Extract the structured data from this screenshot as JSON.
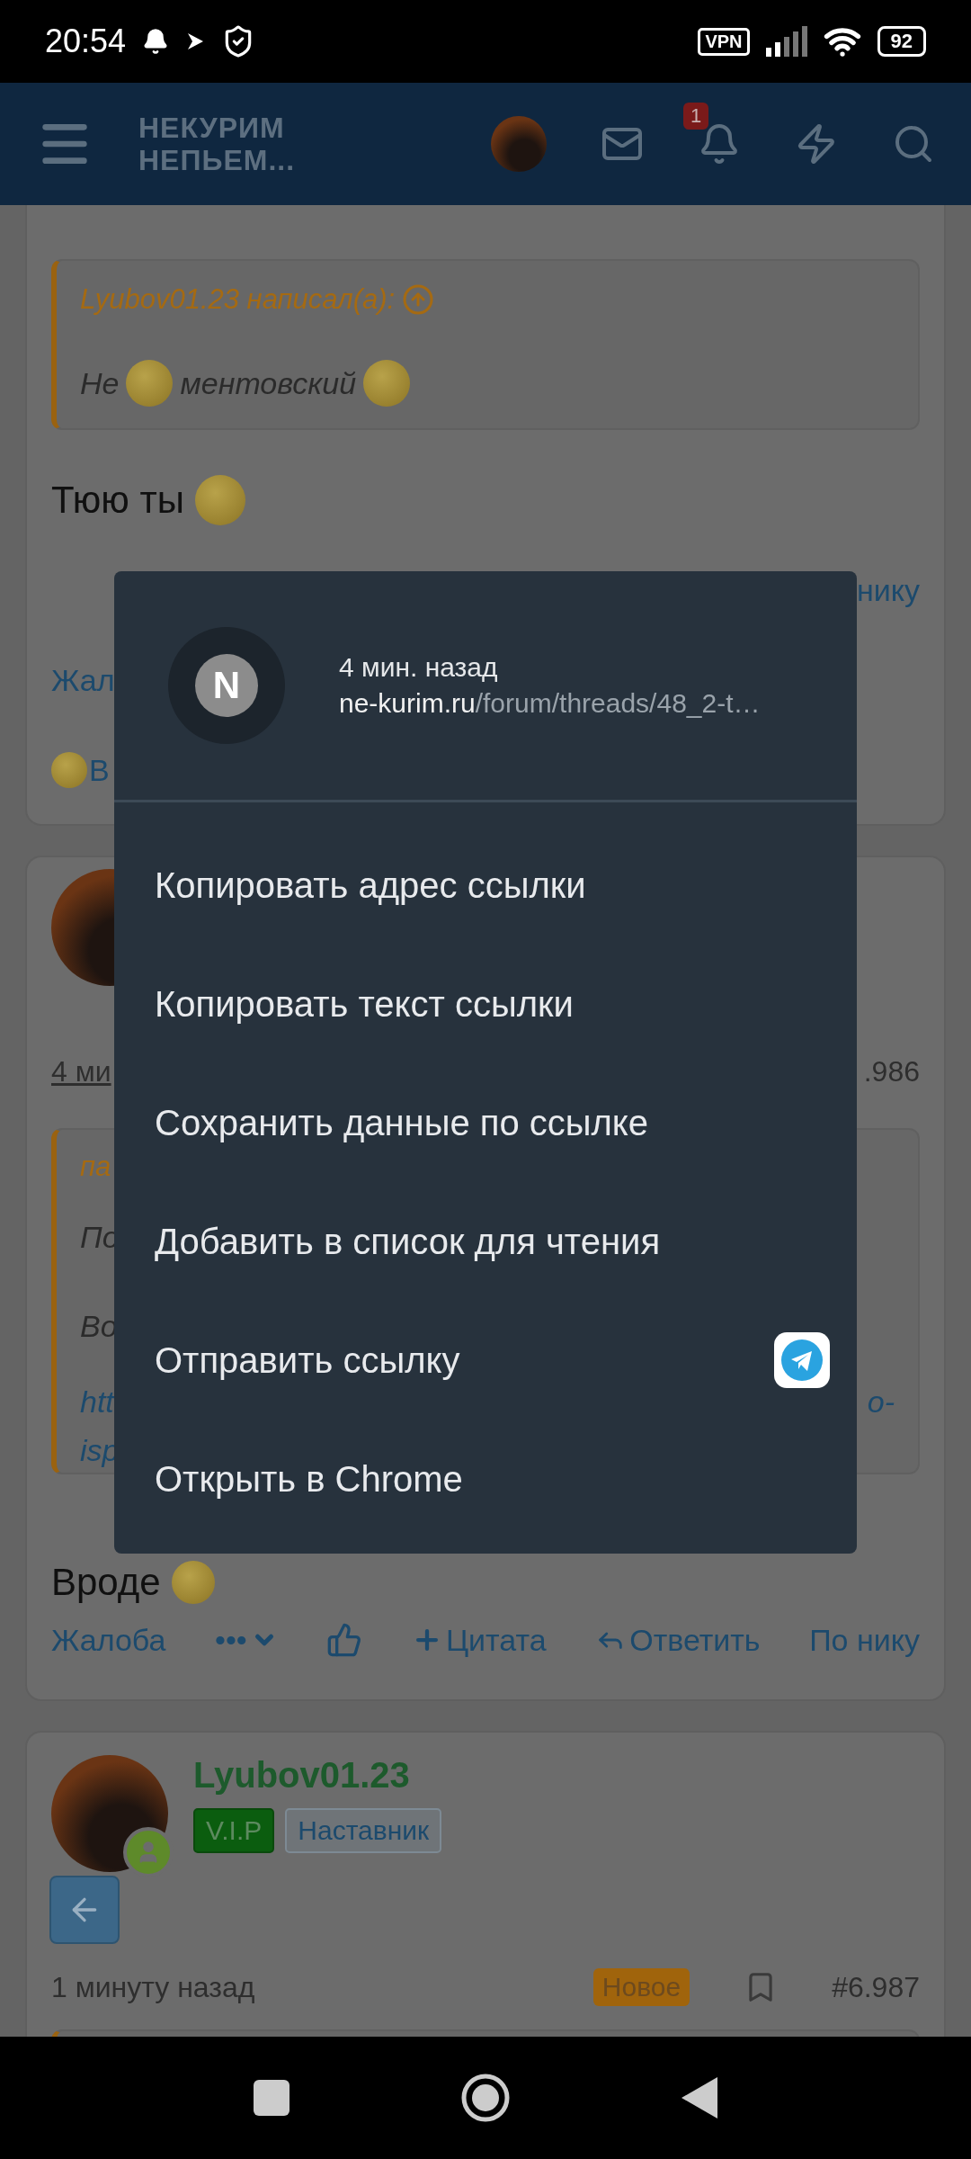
{
  "status_bar": {
    "time": "20:54",
    "vpn": "VPN",
    "battery": "92"
  },
  "header": {
    "logo_lines": [
      "НЕКУРИМ",
      "НЕПЬЕМ..."
    ],
    "notification_count": "1"
  },
  "post_1": {
    "quote_author": "Lyubov01.23 написал(а):",
    "quote_parts": [
      "Не",
      "ментовский"
    ],
    "message": "Тюю ты",
    "fragment_right": "нику",
    "fragment_left": "Жал",
    "reaction_fragment": "В"
  },
  "post_2": {
    "time_fragment": "4 ми",
    "number_fragment": ".986",
    "quote_lines": [
      {
        "kind": "author",
        "left": "па"
      },
      {
        "kind": "text",
        "left": "По"
      },
      {
        "kind": "text",
        "left": "Во"
      },
      {
        "kind": "link",
        "left": "htt",
        "right": "o-"
      },
      {
        "kind": "link",
        "left": "isp"
      }
    ],
    "message": "Вроде",
    "actions": [
      {
        "kind": "report",
        "label": "Жалоба"
      },
      {
        "kind": "more",
        "label": "•••"
      },
      {
        "kind": "like"
      },
      {
        "kind": "quote",
        "label": "Цитата"
      },
      {
        "kind": "reply",
        "label": "Ответить"
      },
      {
        "kind": "nick",
        "label": "По нику"
      }
    ]
  },
  "post_3": {
    "author": "Lyubov01.23",
    "online": true,
    "badges": [
      {
        "kind": "vip",
        "label": "V.I.P"
      },
      {
        "kind": "role",
        "label": "Наставник"
      }
    ],
    "time": "1 минуту назад",
    "new_label": "Новое",
    "number": "#6.987"
  },
  "context_menu": {
    "favicon_letter": "N",
    "time": "4 мин. назад",
    "url_host": "ne-kurim.ru",
    "url_path": "/forum/threads/48_2-t…",
    "items": [
      {
        "kind": "plain",
        "label": "Копировать адрес ссылки"
      },
      {
        "kind": "plain",
        "label": "Копировать текст ссылки"
      },
      {
        "kind": "plain",
        "label": "Сохранить данные по ссылке"
      },
      {
        "kind": "plain",
        "label": "Добавить в список для чтения"
      },
      {
        "kind": "share",
        "label": "Отправить ссылку"
      },
      {
        "kind": "plain",
        "label": "Открыть в Chrome"
      }
    ]
  }
}
